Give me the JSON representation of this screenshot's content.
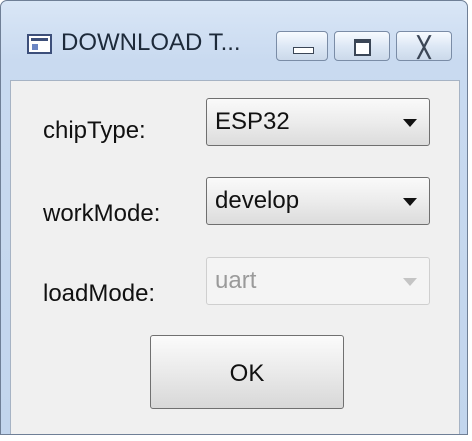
{
  "window": {
    "title": "DOWNLOAD T...",
    "close_glyph": "╳"
  },
  "form": {
    "chip_type": {
      "label": "chipType:",
      "value": "ESP32"
    },
    "work_mode": {
      "label": "workMode:",
      "value": "develop"
    },
    "load_mode": {
      "label": "loadMode:",
      "value": "uart",
      "disabled": true
    }
  },
  "buttons": {
    "ok_label": "OK"
  },
  "icons": {
    "app": "window-app-icon",
    "minimize": "minimize-icon",
    "maximize": "maximize-icon",
    "close": "close-icon",
    "dropdown": "chevron-down-icon"
  }
}
